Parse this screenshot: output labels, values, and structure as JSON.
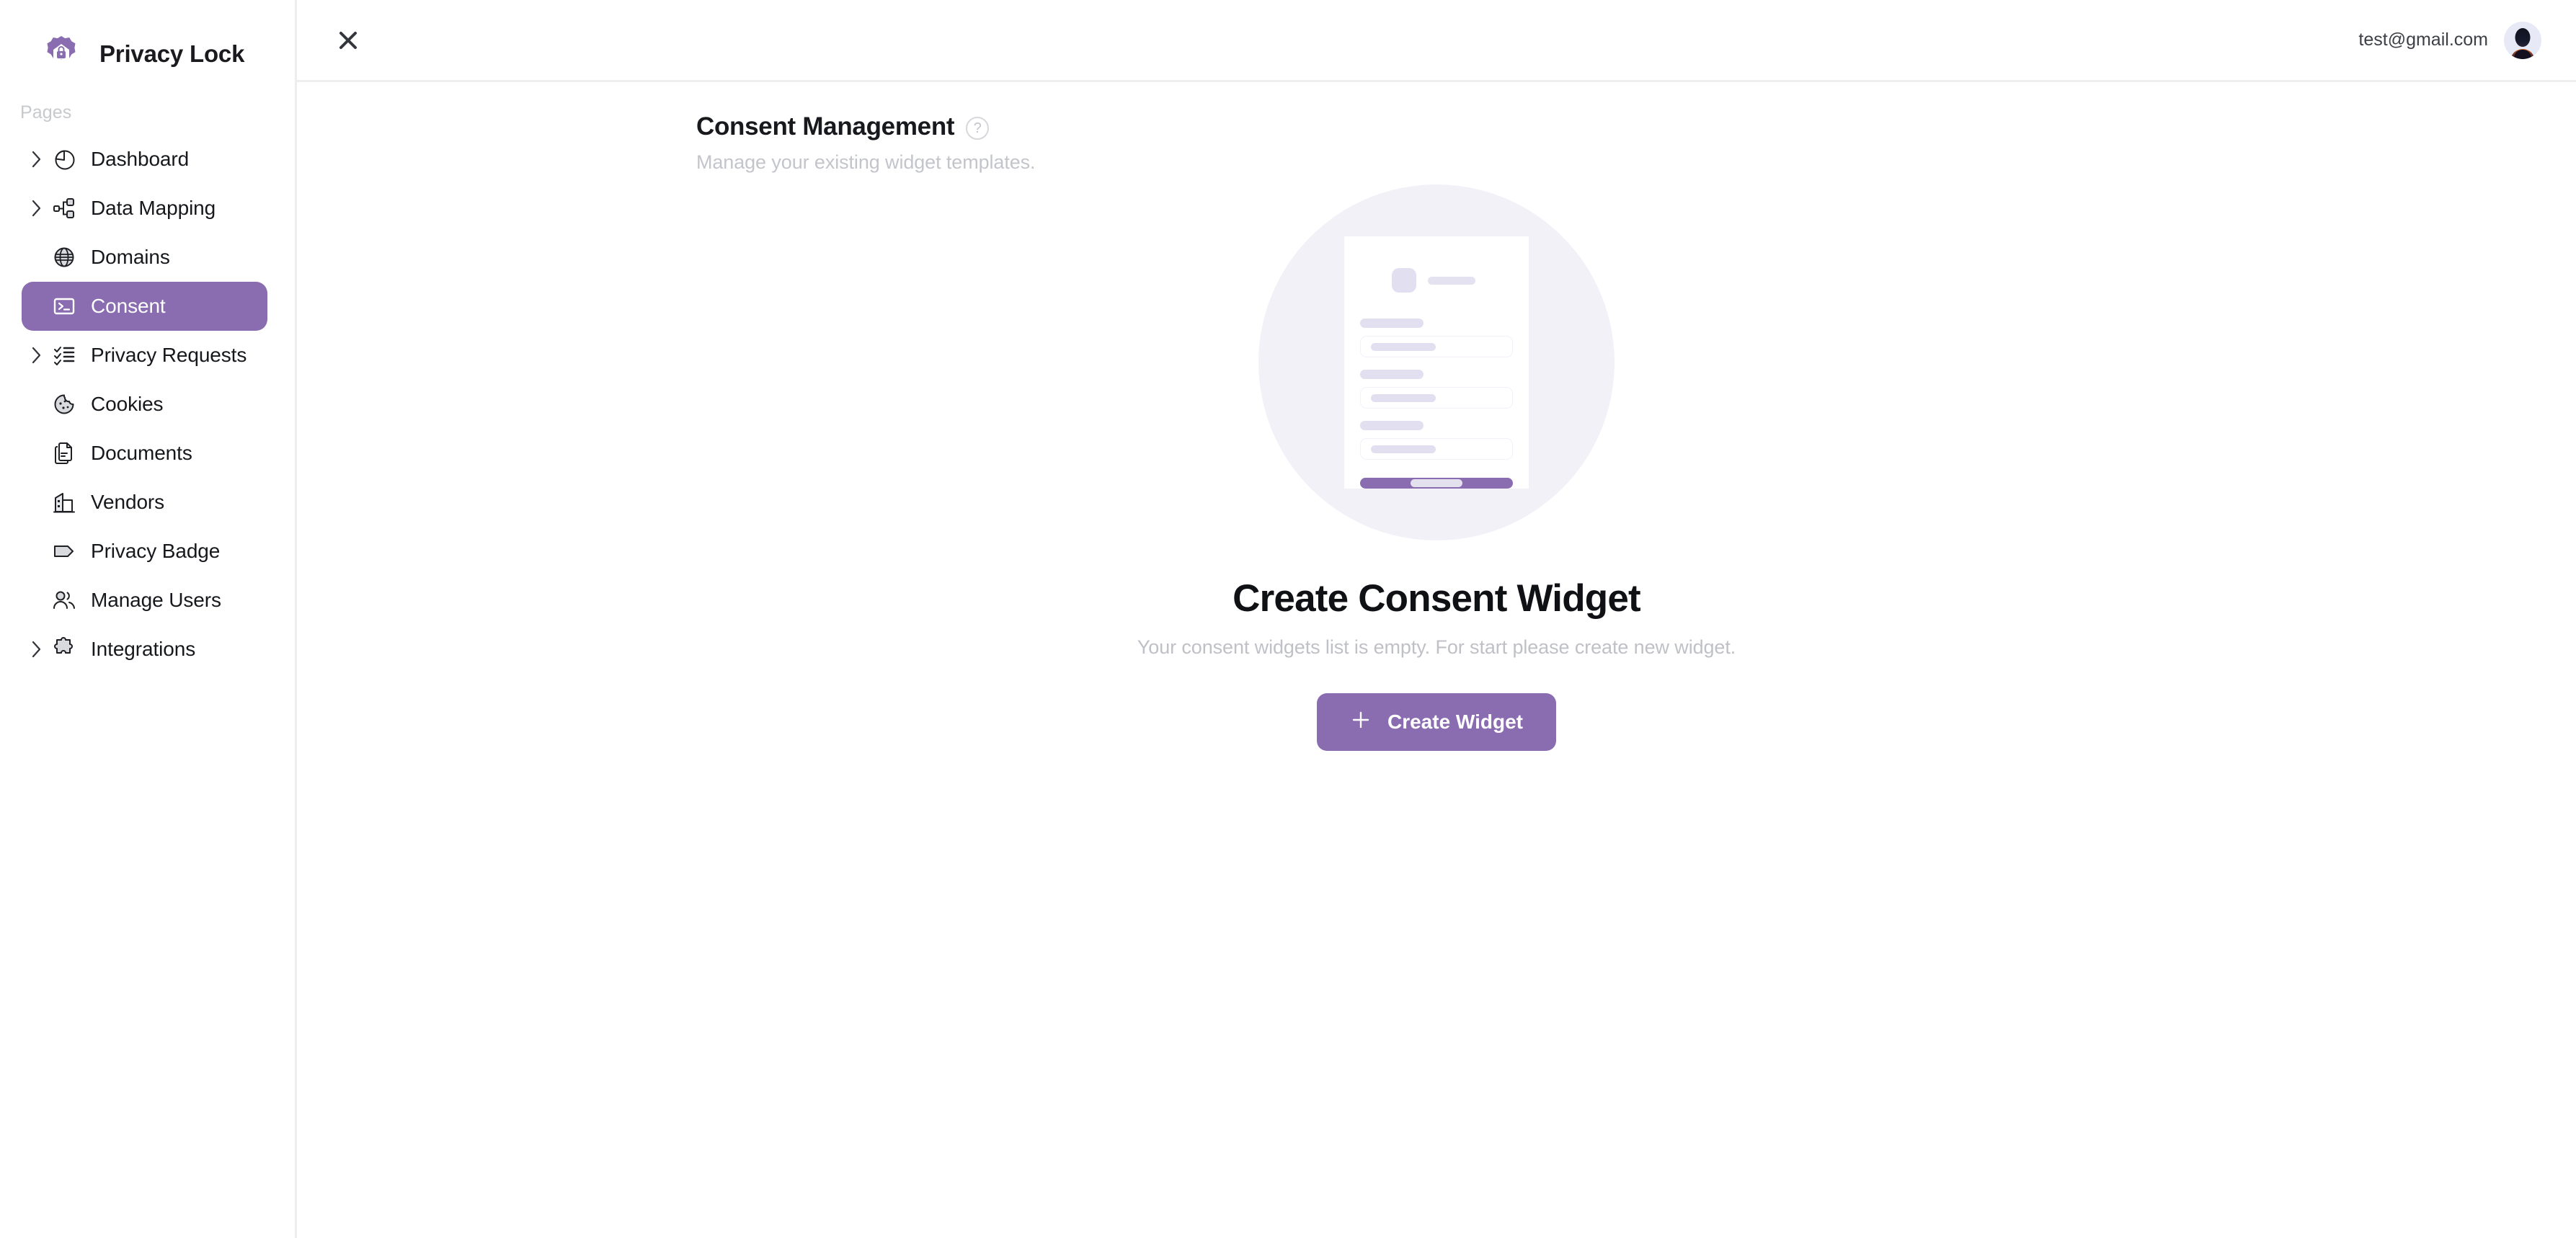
{
  "brand": {
    "name": "Privacy Lock",
    "logo_icon": "privacy-lock-badge-icon",
    "accent_color": "#8a6cb0"
  },
  "sidebar": {
    "section_label": "Pages",
    "items": [
      {
        "label": "Dashboard",
        "icon": "pie-chart-icon",
        "expandable": true,
        "active": false
      },
      {
        "label": "Data Mapping",
        "icon": "hierarchy-icon",
        "expandable": true,
        "active": false
      },
      {
        "label": "Domains",
        "icon": "globe-icon",
        "expandable": false,
        "active": false
      },
      {
        "label": "Consent",
        "icon": "terminal-icon",
        "expandable": false,
        "active": true
      },
      {
        "label": "Privacy Requests",
        "icon": "checklist-icon",
        "expandable": true,
        "active": false
      },
      {
        "label": "Cookies",
        "icon": "cookie-icon",
        "expandable": false,
        "active": false
      },
      {
        "label": "Documents",
        "icon": "documents-icon",
        "expandable": false,
        "active": false
      },
      {
        "label": "Vendors",
        "icon": "building-icon",
        "expandable": false,
        "active": false
      },
      {
        "label": "Privacy Badge",
        "icon": "tag-icon",
        "expandable": false,
        "active": false
      },
      {
        "label": "Manage Users",
        "icon": "users-icon",
        "expandable": false,
        "active": false
      },
      {
        "label": "Integrations",
        "icon": "puzzle-piece-icon",
        "expandable": true,
        "active": false
      }
    ]
  },
  "topbar": {
    "close_icon": "close-icon",
    "user_email": "test@gmail.com",
    "avatar_icon": "user-avatar"
  },
  "page": {
    "title": "Consent Management",
    "help_icon": "help-circle-icon",
    "subtitle": "Manage your existing widget templates."
  },
  "empty_state": {
    "illustration_icon": "consent-widget-form-illustration",
    "title": "Create Consent Widget",
    "description": "Your consent widgets list is empty. For start please create new widget.",
    "button_label": "Create Widget",
    "button_icon": "plus-icon"
  }
}
